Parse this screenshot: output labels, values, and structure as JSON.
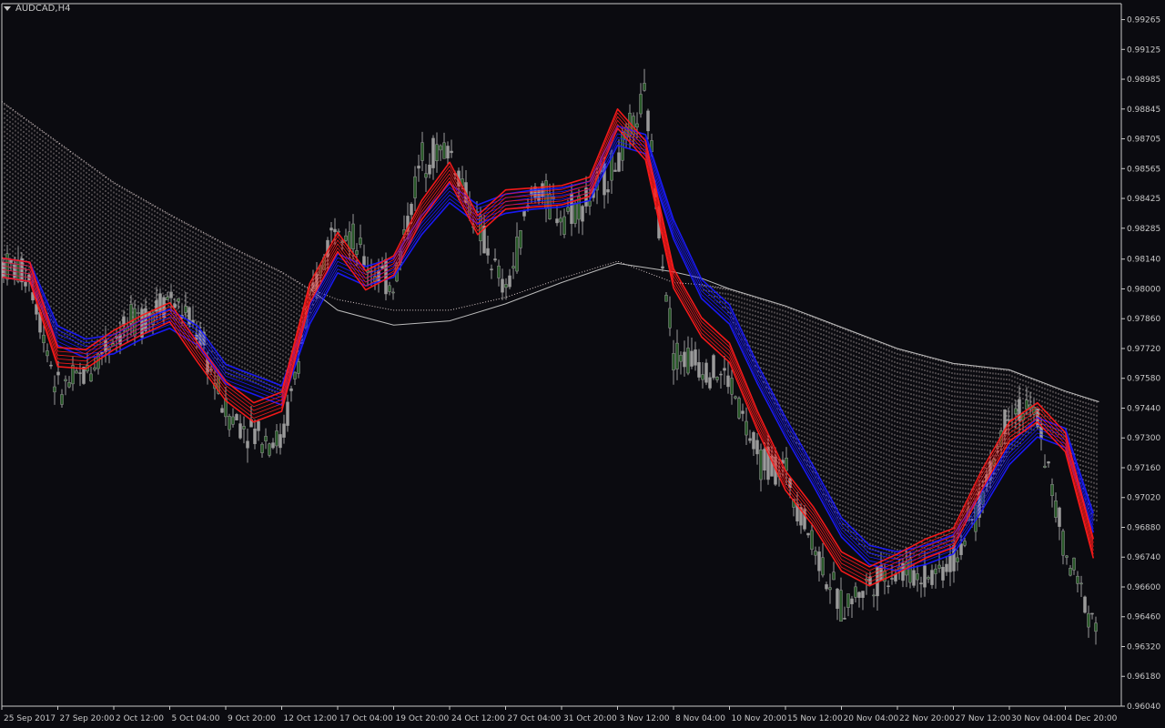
{
  "window": {
    "symbol_title": "AUDCAD,H4",
    "menu_icon": "triangle-down-icon"
  },
  "colors": {
    "background": "#0b0b10",
    "axis": "#c8c8c8",
    "candle": "#9a9a9a",
    "candle_bull_fill": "#2a5a2a",
    "ribbon_fast": "#ff1a1a",
    "ribbon_slow": "#1a1aff",
    "cloud": "#d8c8c8",
    "long_ma": "#bbbbbb"
  },
  "chart_data": {
    "type": "line",
    "title": "AUDCAD,H4",
    "xlabel": "",
    "ylabel": "",
    "ylim": [
      0.9604,
      0.9934
    ],
    "grid": false,
    "y_ticks": [
      "0.99265",
      "0.99125",
      "0.98985",
      "0.98845",
      "0.98705",
      "0.98565",
      "0.98425",
      "0.98285",
      "0.98140",
      "0.98000",
      "0.97860",
      "0.97720",
      "0.97580",
      "0.97440",
      "0.97300",
      "0.97160",
      "0.97020",
      "0.96880",
      "0.96740",
      "0.96600",
      "0.96460",
      "0.96320",
      "0.96180",
      "0.96040"
    ],
    "x_ticks": [
      "25 Sep 2017",
      "27 Sep 20:00",
      "2 Oct 12:00",
      "5 Oct 04:00",
      "9 Oct 20:00",
      "12 Oct 12:00",
      "17 Oct 04:00",
      "19 Oct 20:00",
      "24 Oct 12:00",
      "27 Oct 04:00",
      "31 Oct 20:00",
      "3 Nov 12:00",
      "8 Nov 04:00",
      "10 Nov 20:00",
      "15 Nov 12:00",
      "20 Nov 04:00",
      "22 Nov 20:00",
      "27 Nov 12:00",
      "30 Nov 04:00",
      "4 Dec 20:00"
    ],
    "series": [
      {
        "role": "price",
        "x": [
          0,
          0.5,
          1,
          1.5,
          2,
          2.5,
          3,
          3.5,
          4,
          4.5,
          5,
          5.5,
          6,
          6.5,
          7,
          7.5,
          8,
          8.5,
          9,
          9.5,
          10,
          10.5,
          11,
          11.5,
          12,
          12.5,
          13,
          13.5,
          14,
          14.5,
          15,
          15.5,
          16,
          16.5,
          17,
          17.5,
          18,
          18.5,
          19,
          19.5
        ],
        "values": [
          0.9812,
          0.9806,
          0.9752,
          0.976,
          0.9778,
          0.9786,
          0.9797,
          0.978,
          0.9742,
          0.9733,
          0.9728,
          0.9792,
          0.9836,
          0.9812,
          0.9802,
          0.9862,
          0.9866,
          0.983,
          0.9797,
          0.9848,
          0.9835,
          0.9842,
          0.986,
          0.989,
          0.977,
          0.9765,
          0.9757,
          0.972,
          0.9715,
          0.968,
          0.965,
          0.9662,
          0.9668,
          0.9665,
          0.9672,
          0.97,
          0.9745,
          0.974,
          0.9675,
          0.9645
        ]
      },
      {
        "role": "fast-ribbon",
        "x": [
          0,
          0.5,
          1,
          1.5,
          2,
          2.5,
          3,
          3.5,
          4,
          4.5,
          5,
          5.5,
          6,
          6.5,
          7,
          7.5,
          8,
          8.5,
          9,
          9.5,
          10,
          10.5,
          11,
          11.5,
          12,
          12.5,
          13,
          13.5,
          14,
          14.5,
          15,
          15.5,
          16,
          16.5,
          17,
          17.5,
          18,
          18.5,
          19,
          19.5
        ],
        "values": [
          0.981,
          0.9808,
          0.9768,
          0.9767,
          0.9776,
          0.9783,
          0.9789,
          0.977,
          0.9752,
          0.9742,
          0.9747,
          0.9798,
          0.9822,
          0.9804,
          0.9811,
          0.9837,
          0.9855,
          0.983,
          0.9842,
          0.9843,
          0.9844,
          0.9848,
          0.988,
          0.9865,
          0.9805,
          0.9782,
          0.977,
          0.9738,
          0.971,
          0.9693,
          0.9672,
          0.9665,
          0.9671,
          0.9678,
          0.9683,
          0.971,
          0.9733,
          0.9742,
          0.9728,
          0.9678
        ]
      },
      {
        "role": "slow-ribbon",
        "x": [
          0,
          0.5,
          1,
          1.5,
          2,
          2.5,
          3,
          3.5,
          4,
          4.5,
          5,
          5.5,
          6,
          6.5,
          7,
          7.5,
          8,
          8.5,
          9,
          9.5,
          10,
          10.5,
          11,
          11.5,
          12,
          12.5,
          13,
          13.5,
          14,
          14.5,
          15,
          15.5,
          16,
          16.5,
          17,
          17.5,
          18,
          18.5,
          19,
          19.5
        ],
        "values": [
          0.981,
          0.9808,
          0.9778,
          0.9772,
          0.9774,
          0.9781,
          0.9786,
          0.9778,
          0.976,
          0.9755,
          0.975,
          0.9788,
          0.9812,
          0.9806,
          0.981,
          0.983,
          0.9845,
          0.9835,
          0.984,
          0.9842,
          0.9843,
          0.9846,
          0.9872,
          0.9868,
          0.9828,
          0.98,
          0.9788,
          0.976,
          0.9735,
          0.9712,
          0.9688,
          0.9675,
          0.9672,
          0.9675,
          0.968,
          0.97,
          0.9722,
          0.9735,
          0.973,
          0.969
        ]
      },
      {
        "role": "cloud-upper",
        "x": [
          0,
          1,
          2,
          3,
          4,
          5,
          5.5,
          6,
          7,
          8,
          9,
          10,
          11,
          12,
          12.5,
          13,
          14,
          15,
          16,
          17,
          18,
          19,
          19.6
        ],
        "values": [
          0.9888,
          0.9869,
          0.985,
          0.9835,
          0.9821,
          0.9808,
          0.98,
          0.9795,
          0.979,
          0.979,
          0.9796,
          0.9805,
          0.9813,
          0.9803,
          0.9802,
          0.98,
          0.9792,
          0.9782,
          0.9772,
          0.9765,
          0.9762,
          0.9752,
          0.9747
        ]
      },
      {
        "role": "long-ma",
        "x": [
          5.5,
          6,
          7,
          8,
          9,
          10,
          11,
          12,
          12.5,
          13,
          14,
          15,
          16,
          17,
          18,
          19,
          19.6
        ],
        "values": [
          0.98,
          0.979,
          0.9783,
          0.9785,
          0.9793,
          0.9803,
          0.9812,
          0.9808,
          0.9805,
          0.98,
          0.9792,
          0.9782,
          0.9772,
          0.9765,
          0.9762,
          0.9752,
          0.9747
        ]
      }
    ]
  }
}
